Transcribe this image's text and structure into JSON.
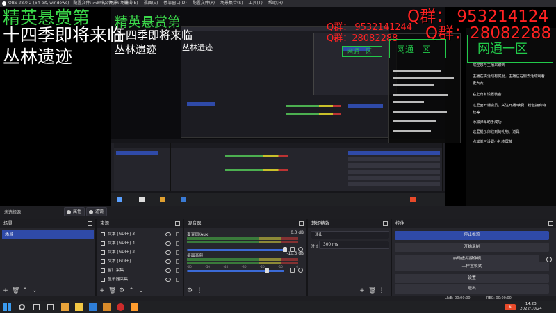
{
  "window": {
    "title": "OBS 28.0.2 (64-bit, windows) - 配置文件: 未命名 - 场景: 场景",
    "menu": [
      "文件(F)",
      "编辑(E)",
      "视图(V)",
      "停靠窗口(D)",
      "配置文件(P)",
      "场景集合(S)",
      "工具(T)",
      "帮助(H)"
    ]
  },
  "overlay": {
    "title_green": "精英悬赏第",
    "season_line": "十四季即将来临",
    "subtitle": "丛林遗迹",
    "mid_green": "精英悬赏第",
    "mid_season": "十四季即将来临",
    "mid_subtitle": "丛林遗迹",
    "small_subtitle": "丛林遗迹",
    "qun_main": "Q群：  953214124",
    "qun_second": "Q群：28082288",
    "qun_mid": "Q群：  9532141244",
    "qun_mid2": "Q群：28082288",
    "qun_small": "Q群：  953214124",
    "net_zone": "网通一区",
    "net_zone_mid": "网通一区",
    "net_zone_small": "网通一区"
  },
  "chat": {
    "messages": [
      "欢迎您与主播来聊天",
      "主播在搞活动有奖励，主播往右侧去活动观看",
      "更大大",
      "右上角有设置装备",
      "这里面开通会员，关注开播/续费，粉丝拥有特",
      "权等",
      "添加弹幕助手成功",
      "这里提示你收到的礼物、道具",
      "点其单可设置小礼物屏蔽"
    ]
  },
  "toolbar": {
    "no_source": "未选择源",
    "properties_btn": "属性",
    "filters_btn": "滤镜"
  },
  "scenes": {
    "header": "场景",
    "items": [
      "场景"
    ]
  },
  "sources": {
    "header": "来源",
    "items": [
      {
        "name": "文本 (GDI+) 3",
        "icon": "text-icon"
      },
      {
        "name": "文本 (GDI+) 4",
        "icon": "text-icon"
      },
      {
        "name": "文本 (GDI+) 2",
        "icon": "text-icon"
      },
      {
        "name": "文本 (GDI+)",
        "icon": "text-icon"
      },
      {
        "name": "窗口采集",
        "icon": "window-icon"
      },
      {
        "name": "显示器采集",
        "icon": "monitor-icon"
      }
    ]
  },
  "mixer": {
    "header": "混音器",
    "tracks": [
      {
        "name": "麦克风/Aux",
        "db": "0.0 dB"
      },
      {
        "name": "桌面音频",
        "db": "-10.5 dB"
      }
    ],
    "ticks": [
      "-60",
      "-55",
      "-50",
      "-45",
      "-40",
      "-35",
      "-30",
      "-25",
      "-20",
      "-15",
      "-10",
      "-5",
      "0"
    ]
  },
  "transitions": {
    "header": "转场特效",
    "type": "淡出",
    "duration_label": "时长",
    "duration_value": "300 ms"
  },
  "controls": {
    "header": "控件",
    "buttons": [
      "停止推流",
      "开始录制",
      "启动虚拟摄像机",
      "工作室模式",
      "设置",
      "退出"
    ]
  },
  "status": {
    "live": "LIVE: 00:00:00",
    "rec": "REC: 00:00:00"
  },
  "taskbar": {
    "time": "14:23",
    "date": "2022/10/24",
    "lang": "S"
  }
}
